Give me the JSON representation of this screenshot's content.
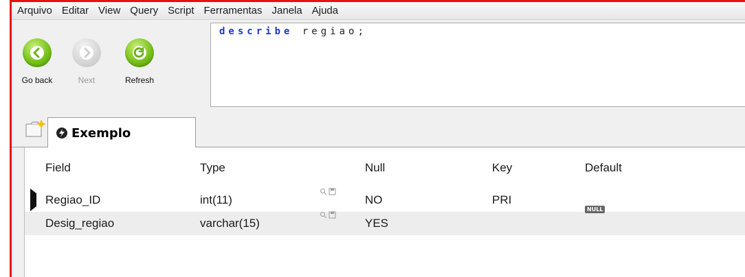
{
  "menu": [
    "Arquivo",
    "Editar",
    "View",
    "Query",
    "Script",
    "Ferramentas",
    "Janela",
    "Ajuda"
  ],
  "toolbar": {
    "go_back": "Go back",
    "next": "Next",
    "refresh": "Refresh"
  },
  "editor": {
    "keyword": "describe",
    "identifier": "regiao;"
  },
  "tab": {
    "label": "Exemplo"
  },
  "grid": {
    "columns": [
      "Field",
      "Type",
      "Null",
      "Key",
      "Default"
    ],
    "rows": [
      {
        "field": "Regiao_ID",
        "type": "int(11)",
        "null": "NO",
        "key": "PRI",
        "default": ""
      },
      {
        "field": "Desig_regiao",
        "type": "varchar(15)",
        "null": "YES",
        "key": "",
        "default": "NULL"
      }
    ]
  },
  "colors": {
    "frame_border": "#e81010",
    "keyword": "#1e36d6",
    "button_green": "#78c21a"
  }
}
